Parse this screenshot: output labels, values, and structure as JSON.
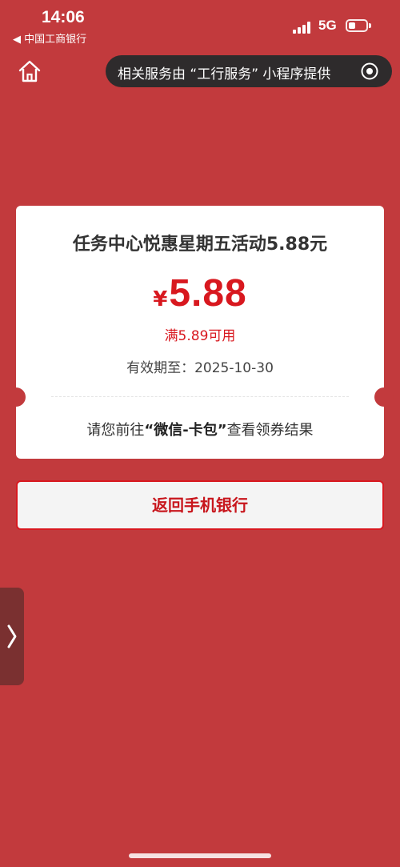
{
  "status_bar": {
    "time": "14:06",
    "back_app": "◀ 中国工商银行",
    "network": "5G"
  },
  "nav": {
    "home_icon": "home-icon",
    "service_notice": "相关服务由 “工行服务” 小程序提供",
    "target_icon": "target-icon"
  },
  "coupon": {
    "title": "任务中心悦惠星期五活动5.88元",
    "currency": "¥",
    "amount": "5.88",
    "condition": "满5.89可用",
    "validity": "有效期至：2025-10-30",
    "notice_prefix": "请您前往",
    "notice_highlight": "“微信-卡包”",
    "notice_suffix": "查看领券结果"
  },
  "return_button": "返回手机银行",
  "side_tab_icon": "chevron-right-icon",
  "colors": {
    "background": "#c23a3d",
    "accent": "#d8181f",
    "card": "#ffffff",
    "pill": "#2e2b2c"
  }
}
